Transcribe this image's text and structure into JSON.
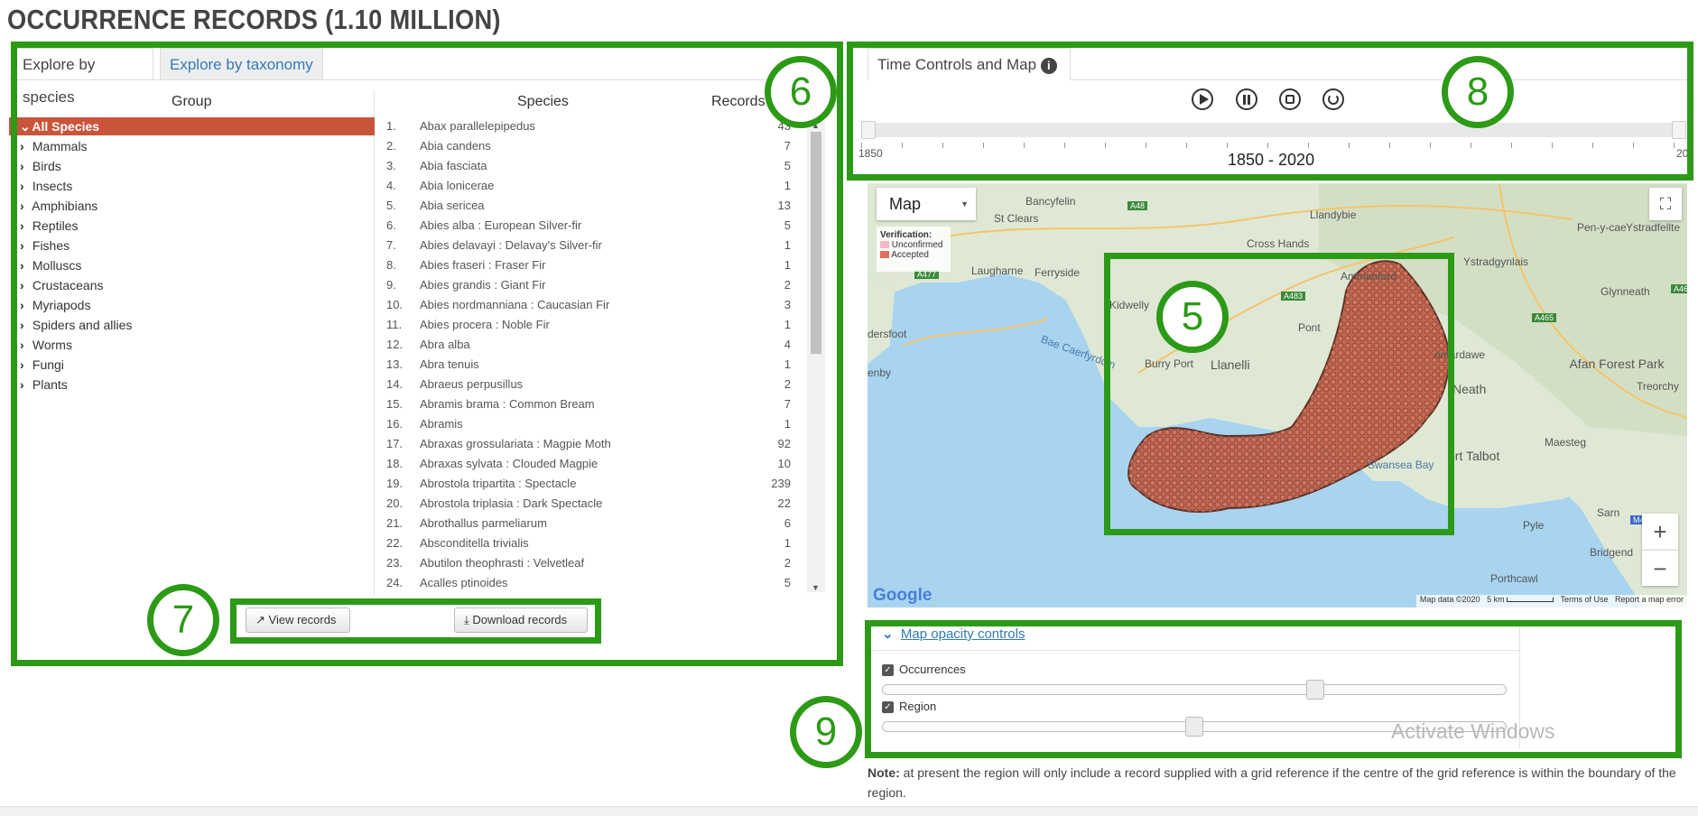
{
  "page": {
    "title": "OCCURRENCE RECORDS (1.10 MILLION)"
  },
  "callouts": {
    "b5": "5",
    "b6": "6",
    "b7": "7",
    "b8": "8",
    "b9": "9"
  },
  "species_panel": {
    "tabs": [
      "Explore by species",
      "Explore by taxonomy"
    ],
    "group_header": "Group",
    "species_header": "Species",
    "records_header": "Records",
    "groups": [
      "All Species",
      "Mammals",
      "Birds",
      "Insects",
      "Amphibians",
      "Reptiles",
      "Fishes",
      "Molluscs",
      "Crustaceans",
      "Myriapods",
      "Spiders and allies",
      "Worms",
      "Fungi",
      "Plants"
    ],
    "species": [
      {
        "n": "1.",
        "name": "Abax parallelepipedus",
        "rec": "43"
      },
      {
        "n": "2.",
        "name": "Abia candens",
        "rec": "7"
      },
      {
        "n": "3.",
        "name": "Abia fasciata",
        "rec": "5"
      },
      {
        "n": "4.",
        "name": "Abia lonicerae",
        "rec": "1"
      },
      {
        "n": "5.",
        "name": "Abia sericea",
        "rec": "13"
      },
      {
        "n": "6.",
        "name": "Abies alba : European Silver-fir",
        "rec": "5"
      },
      {
        "n": "7.",
        "name": "Abies delavayi : Delavay's Silver-fir",
        "rec": "1"
      },
      {
        "n": "8.",
        "name": "Abies fraseri : Fraser Fir",
        "rec": "1"
      },
      {
        "n": "9.",
        "name": "Abies grandis : Giant Fir",
        "rec": "2"
      },
      {
        "n": "10.",
        "name": "Abies nordmanniana : Caucasian Fir",
        "rec": "3"
      },
      {
        "n": "11.",
        "name": "Abies procera : Noble Fir",
        "rec": "1"
      },
      {
        "n": "12.",
        "name": "Abra alba",
        "rec": "4"
      },
      {
        "n": "13.",
        "name": "Abra tenuis",
        "rec": "1"
      },
      {
        "n": "14.",
        "name": "Abraeus perpusillus",
        "rec": "2"
      },
      {
        "n": "15.",
        "name": "Abramis brama : Common Bream",
        "rec": "7"
      },
      {
        "n": "16.",
        "name": "Abramis",
        "rec": "1"
      },
      {
        "n": "17.",
        "name": "Abraxas grossulariata : Magpie Moth",
        "rec": "92"
      },
      {
        "n": "18.",
        "name": "Abraxas sylvata : Clouded Magpie",
        "rec": "10"
      },
      {
        "n": "19.",
        "name": "Abrostola tripartita : Spectacle",
        "rec": "239"
      },
      {
        "n": "20.",
        "name": "Abrostola triplasia : Dark Spectacle",
        "rec": "22"
      },
      {
        "n": "21.",
        "name": "Abrothallus parmeliarum",
        "rec": "6"
      },
      {
        "n": "22.",
        "name": "Absconditella trivialis",
        "rec": "1"
      },
      {
        "n": "23.",
        "name": "Abutilon theophrasti : Velvetleaf",
        "rec": "2"
      },
      {
        "n": "24.",
        "name": "Acalles ptinoides",
        "rec": "5"
      }
    ],
    "view_button": "View records",
    "download_button": "Download records"
  },
  "time_panel": {
    "tab": "Time Controls and Map",
    "range_start": "1850",
    "range_end": "20",
    "range_label": "1850 - 2020",
    "icons": [
      "play-icon",
      "pause-icon",
      "stop-icon",
      "reset-icon"
    ]
  },
  "map": {
    "type_selector": "Map",
    "legend_title": "Verification:",
    "legend_items": [
      {
        "label": "Unconfirmed",
        "color": "#f4b8c0"
      },
      {
        "label": "Accepted",
        "color": "#e0705a"
      }
    ],
    "places": [
      "Bancyfelin",
      "St Clears",
      "Llandybie",
      "Pen-y-cae",
      "Ystradfellte",
      "Cross Hands",
      "Ammanford",
      "Ystradgynlais",
      "Glynneath",
      "Laugharne",
      "Ferryside",
      "Kidwelly",
      "Burry Port",
      "Llanelli",
      "Pont",
      "ontardawe",
      "Afan Forest Park",
      "Treorchy",
      "Maesteg",
      "ort Talbot",
      "Neath",
      "Pyle",
      "Bridgend",
      "Porthcawl",
      "Sarn",
      "dersfoot",
      "enby",
      "Bae Caerfyrddin",
      "Swansea Bay"
    ],
    "roads": [
      "A48",
      "A483",
      "A477",
      "A465",
      "A46",
      "M4"
    ],
    "footer": {
      "data": "Map data ©2020",
      "scale": "5 km",
      "terms": "Terms of Use",
      "report": "Report a map error"
    },
    "google": "Google",
    "zoom_in": "+",
    "zoom_out": "−"
  },
  "opacity": {
    "toggle_label": "Map opacity controls",
    "layers": [
      {
        "label": "Occurrences",
        "checked": true,
        "opacity": 0.7
      },
      {
        "label": "Region",
        "checked": true,
        "opacity": 0.5
      }
    ]
  },
  "watermark": "Activate Windows",
  "note": {
    "label": "Note:",
    "text": " at present the region will only include a record supplied with a grid reference if the centre of the grid reference is within the boundary of the region."
  }
}
